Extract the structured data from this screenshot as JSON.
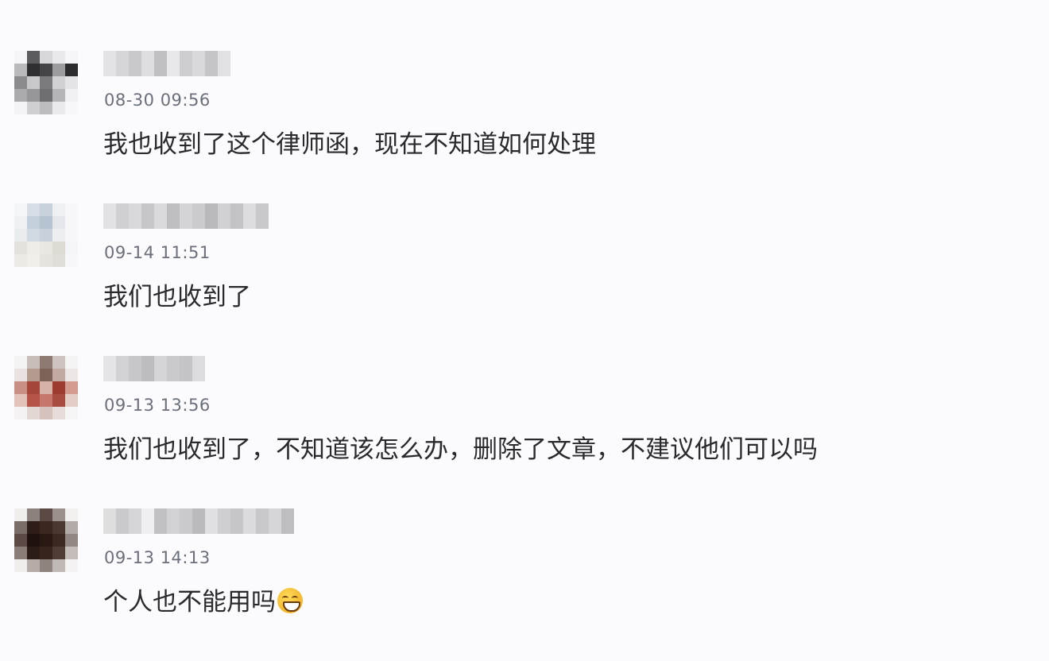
{
  "comments": [
    {
      "timestamp": "08-30 09:56",
      "text": "我也收到了这个律师函，现在不知道如何处理",
      "has_emoji": false
    },
    {
      "timestamp": "09-14 11:51",
      "text": "我们也收到了",
      "has_emoji": false
    },
    {
      "timestamp": "09-13 13:56",
      "text": "我们也收到了，不知道该怎么办，删除了文章，不建议他们可以吗",
      "has_emoji": false
    },
    {
      "timestamp": "09-13 14:13",
      "text": "个人也不能用吗",
      "has_emoji": true,
      "emoji": "grinning-face-emoji"
    }
  ],
  "colors": {
    "background": "#fbfbfe",
    "timestamp": "#6b6f7a",
    "text": "#2a2a2e"
  }
}
